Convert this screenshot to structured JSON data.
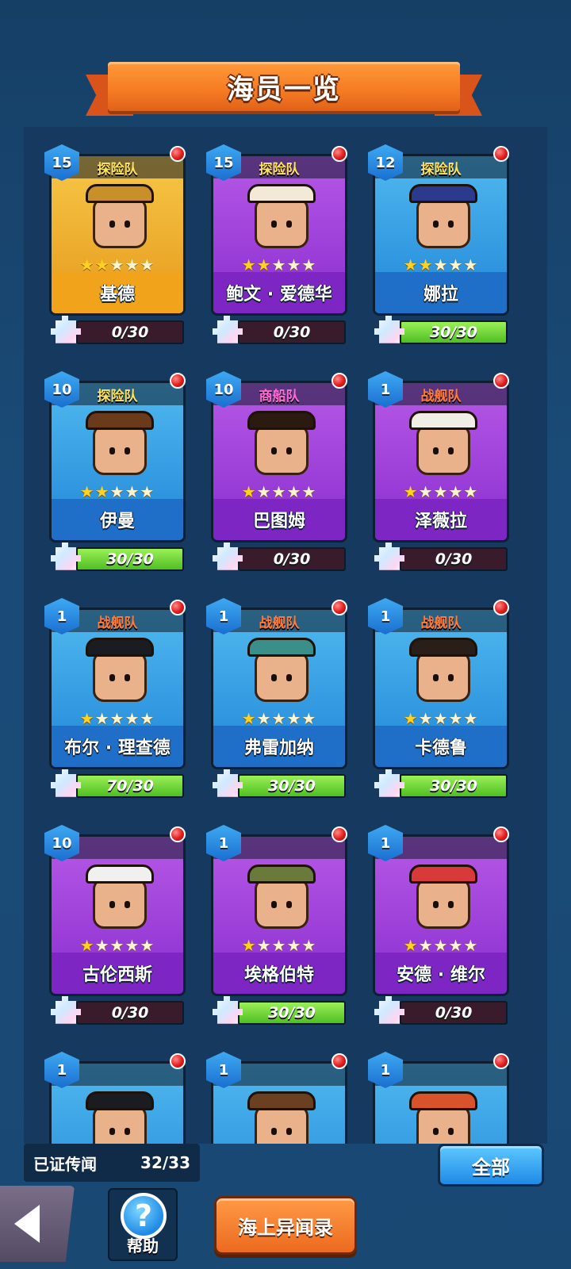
{
  "title": "海员一览",
  "cards": [
    {
      "level": "15",
      "team": "探险队",
      "team_type": "explore",
      "theme": "gold",
      "name": "基德",
      "stars_filled": 2,
      "progress_text": "0/30",
      "progress": 0.0,
      "hat_color": "#c9902a"
    },
    {
      "level": "15",
      "team": "探险队",
      "team_type": "explore",
      "theme": "purple",
      "name": "鲍文 · 爱德华",
      "stars_filled": 2,
      "progress_text": "0/30",
      "progress": 0.0,
      "hat_color": "#f3e9d8"
    },
    {
      "level": "12",
      "team": "探险队",
      "team_type": "explore",
      "theme": "blue",
      "name": "娜拉",
      "stars_filled": 2,
      "progress_text": "30/30",
      "progress": 1.0,
      "hat_color": "#2b3a8c"
    },
    {
      "level": "10",
      "team": "探险队",
      "team_type": "explore",
      "theme": "blue",
      "name": "伊曼",
      "stars_filled": 2,
      "progress_text": "30/30",
      "progress": 1.0,
      "hat_color": "#6b3a1a"
    },
    {
      "level": "10",
      "team": "商船队",
      "team_type": "merchant",
      "theme": "purple",
      "name": "巴图姆",
      "stars_filled": 1,
      "progress_text": "0/30",
      "progress": 0.0,
      "hat_color": "#2a1a10"
    },
    {
      "level": "1",
      "team": "战舰队",
      "team_type": "war",
      "theme": "purple",
      "name": "泽薇拉",
      "stars_filled": 1,
      "progress_text": "0/30",
      "progress": 0.0,
      "hat_color": "#f1eee6"
    },
    {
      "level": "1",
      "team": "战舰队",
      "team_type": "war",
      "theme": "blue",
      "name": "布尔 · 理查德",
      "stars_filled": 1,
      "progress_text": "70/30",
      "progress": 1.0,
      "hat_color": "#1b1b22"
    },
    {
      "level": "1",
      "team": "战舰队",
      "team_type": "war",
      "theme": "blue",
      "name": "弗雷加纳",
      "stars_filled": 1,
      "progress_text": "30/30",
      "progress": 1.0,
      "hat_color": "#3a8f8a"
    },
    {
      "level": "1",
      "team": "战舰队",
      "team_type": "war",
      "theme": "blue",
      "name": "卡德鲁",
      "stars_filled": 1,
      "progress_text": "30/30",
      "progress": 1.0,
      "hat_color": "#2a1f18"
    },
    {
      "level": "10",
      "team": "",
      "team_type": "none",
      "theme": "purple",
      "name": "古伦西斯",
      "stars_filled": 1,
      "progress_text": "0/30",
      "progress": 0.0,
      "hat_color": "#f0f0f0"
    },
    {
      "level": "1",
      "team": "",
      "team_type": "none",
      "theme": "purple",
      "name": "埃格伯特",
      "stars_filled": 1,
      "progress_text": "30/30",
      "progress": 1.0,
      "hat_color": "#6a7a3a"
    },
    {
      "level": "1",
      "team": "",
      "team_type": "none",
      "theme": "purple",
      "name": "安德 · 维尔",
      "stars_filled": 1,
      "progress_text": "0/30",
      "progress": 0.0,
      "hat_color": "#d83a3a"
    },
    {
      "level": "1",
      "team": "",
      "team_type": "none",
      "theme": "blue",
      "name": "",
      "stars_filled": 0,
      "progress_text": "",
      "progress": 0.0,
      "hat_color": "#1b1b22"
    },
    {
      "level": "1",
      "team": "",
      "team_type": "none",
      "theme": "blue",
      "name": "",
      "stars_filled": 0,
      "progress_text": "",
      "progress": 0.0,
      "hat_color": "#6a4020"
    },
    {
      "level": "1",
      "team": "",
      "team_type": "none",
      "theme": "blue",
      "name": "",
      "stars_filled": 0,
      "progress_text": "",
      "progress": 0.0,
      "hat_color": "#d8532a"
    }
  ],
  "legend": {
    "label": "已证传闻",
    "count": "32/33"
  },
  "filter_button": "全部",
  "help_label": "帮助",
  "help_glyph": "?",
  "chronicle_button": "海上异闻录",
  "star_glyph": "★",
  "icons": {
    "back": "back-arrow-icon",
    "help": "help-question-icon",
    "puzzle": "puzzle-piece-icon",
    "notify": "red-notification-dot-icon"
  }
}
